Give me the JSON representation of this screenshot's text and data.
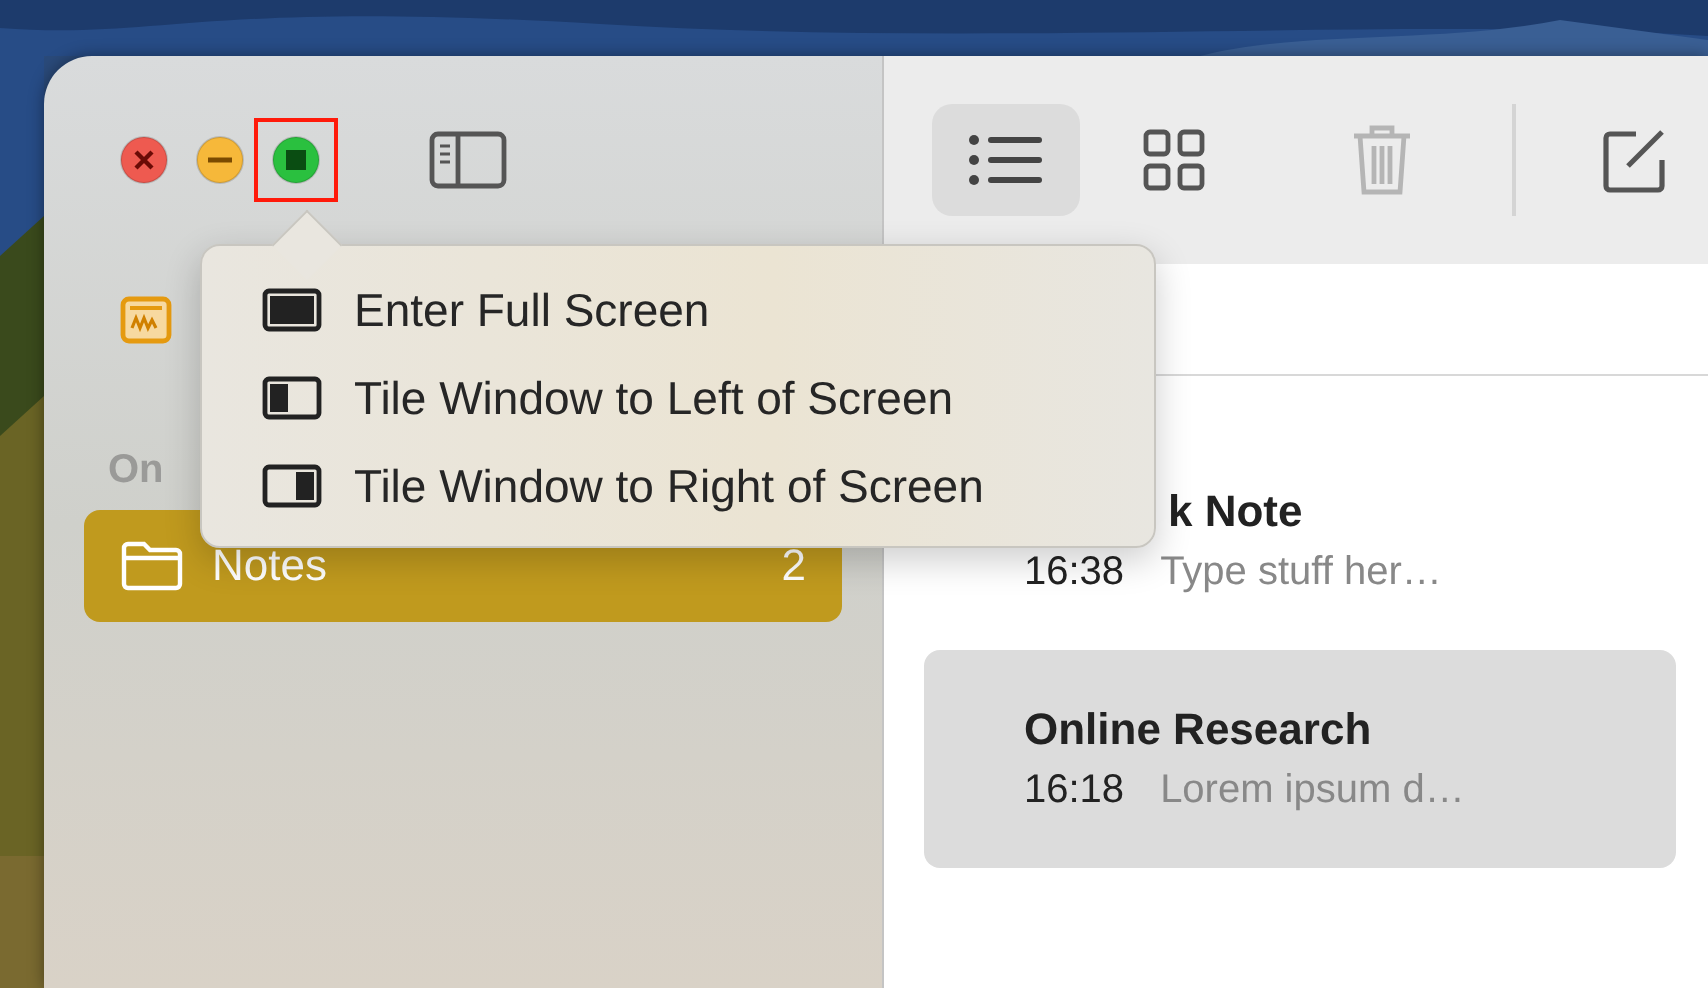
{
  "window": {
    "controls": [
      {
        "kind": "close"
      },
      {
        "kind": "minimize"
      },
      {
        "kind": "zoom",
        "highlighted": true
      }
    ]
  },
  "sidebar": {
    "section_label": "On",
    "folders": [
      {
        "name": "Notes",
        "count": "2",
        "selected": true
      }
    ]
  },
  "toolbar": {
    "views": [
      {
        "kind": "list",
        "selected": true
      },
      {
        "kind": "gallery",
        "selected": false
      }
    ],
    "delete_disabled": true
  },
  "notes": [
    {
      "title": "k Note",
      "time": "16:38",
      "preview": "Type stuff her…",
      "selected": false,
      "title_cut": true
    },
    {
      "title": "Online Research",
      "time": "16:18",
      "preview": "Lorem ipsum d…",
      "selected": true,
      "title_cut": false
    }
  ],
  "popover": {
    "items": [
      {
        "kind": "full",
        "label": "Enter Full Screen"
      },
      {
        "kind": "left",
        "label": "Tile Window to Left of Screen"
      },
      {
        "kind": "right",
        "label": "Tile Window to Right of Screen"
      }
    ]
  }
}
